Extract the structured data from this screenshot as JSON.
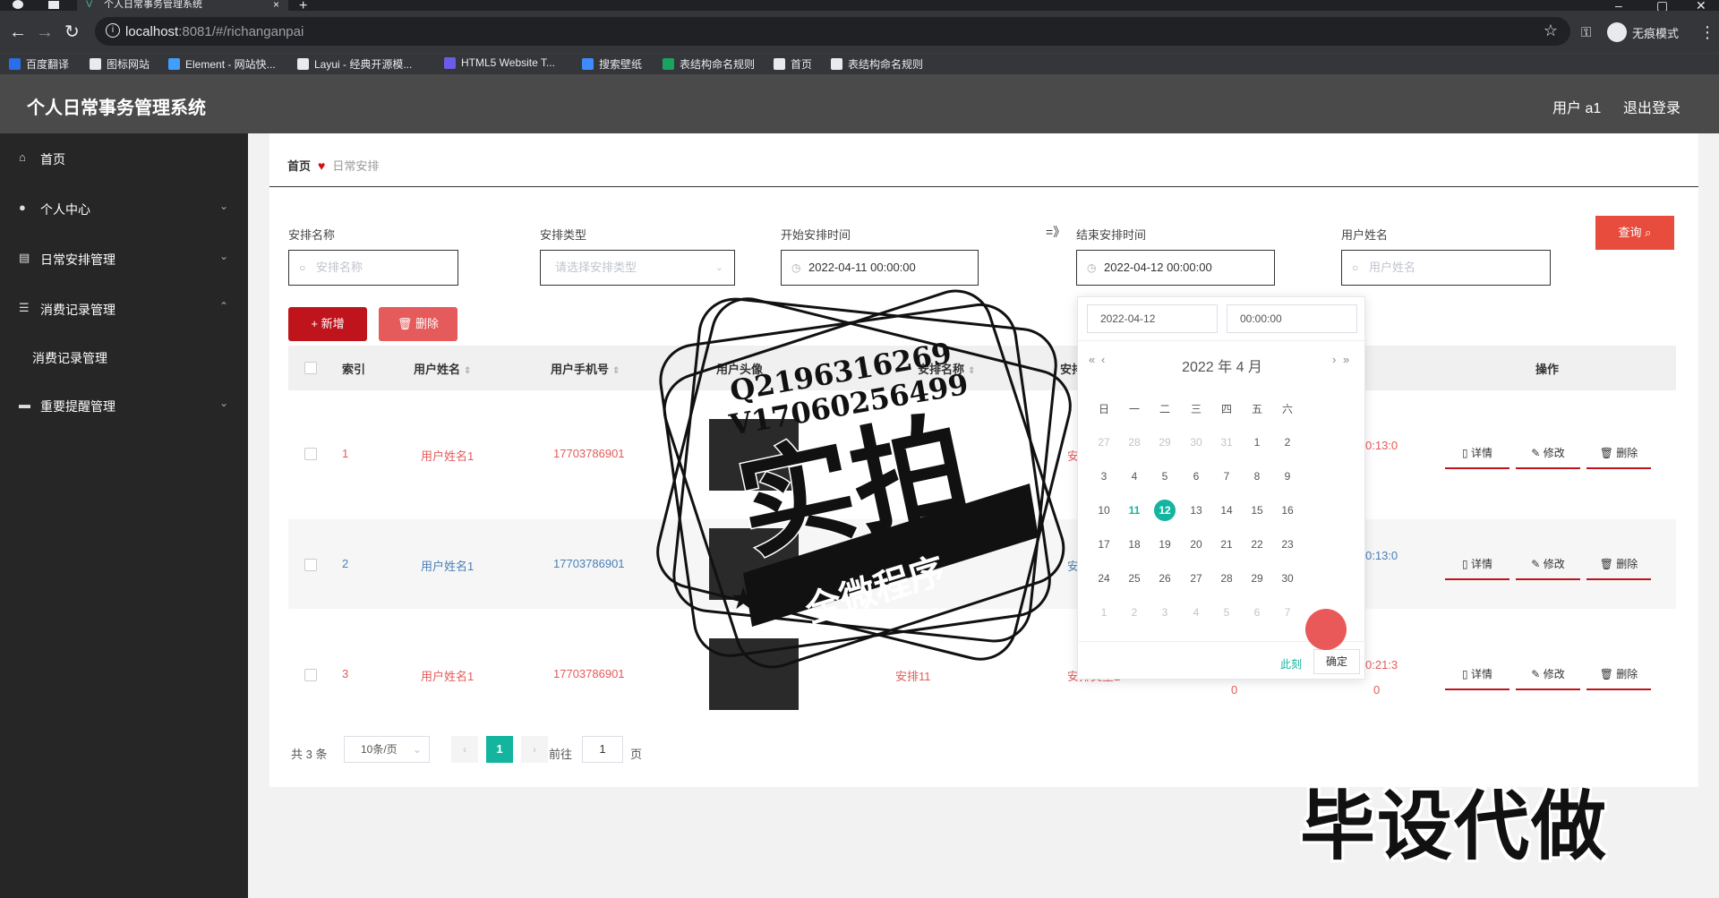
{
  "browser": {
    "tab_title": "个人日常事务管理系统",
    "url_host": "localhost",
    "url_path": ":8081/#/richanganpai",
    "incognito_label": "无痕模式",
    "bookmarks": [
      {
        "label": "百度翻译",
        "color": "#2a6ee8"
      },
      {
        "label": "图标网站",
        "color": "#e8eaed"
      },
      {
        "label": "Element - 网站快...",
        "color": "#409eff"
      },
      {
        "label": "Layui - 经典开源模...",
        "color": "#e8eaed"
      },
      {
        "label": "HTML5 Website T...",
        "color": "#6b5ce7"
      },
      {
        "label": "搜索壁纸",
        "color": "#3d8bfd"
      },
      {
        "label": "表结构命名规则",
        "color": "#1aa260"
      },
      {
        "label": "首页",
        "color": "#e8eaed"
      },
      {
        "label": "表结构命名规则",
        "color": "#e8eaed"
      }
    ]
  },
  "header": {
    "title": "个人日常事务管理系统",
    "user": "用户 a1",
    "logout": "退出登录"
  },
  "sidebar": {
    "items": [
      {
        "label": "首页",
        "icon": "home-icon",
        "arrow": ""
      },
      {
        "label": "个人中心",
        "icon": "user-icon",
        "arrow": "⌄"
      },
      {
        "label": "日常安排管理",
        "icon": "calendar-icon",
        "arrow": "⌄"
      },
      {
        "label": "消费记录管理",
        "icon": "list-icon",
        "arrow": "⌃"
      },
      {
        "label": "消费记录管理",
        "icon": "",
        "arrow": ""
      },
      {
        "label": "重要提醒管理",
        "icon": "bell-icon",
        "arrow": "⌄"
      }
    ]
  },
  "breadcrumb": {
    "home": "首页",
    "current": "日常安排"
  },
  "filters": {
    "name_label": "安排名称",
    "name_placeholder": "安排名称",
    "type_label": "安排类型",
    "type_placeholder": "请选择安排类型",
    "start_label": "开始安排时间",
    "start_value": "2022-04-11 00:00:00",
    "arrow": "=》",
    "end_label": "结束安排时间",
    "end_value": "2022-04-12 00:00:00",
    "user_label": "用户姓名",
    "user_placeholder": "用户姓名",
    "query_btn": "查询"
  },
  "actions": {
    "add": "新增",
    "delete": "删除"
  },
  "table": {
    "headers": [
      "索引",
      "用户姓名",
      "用户手机号",
      "用户头像",
      "安排名称",
      "安排类型",
      "操作"
    ],
    "rows": [
      {
        "index": "1",
        "name": "用户姓名1",
        "phone": "17703786901",
        "arr_name": "",
        "arr_type": "安排类型",
        "time": "0:13:0",
        "count_a": "",
        "count_b": ""
      },
      {
        "index": "2",
        "name": "用户姓名1",
        "phone": "17703786901",
        "arr_name": "",
        "arr_type": "安排类型",
        "time": "0:13:0",
        "count_a": "",
        "count_b": ""
      },
      {
        "index": "3",
        "name": "用户姓名1",
        "phone": "17703786901",
        "arr_name": "安排11",
        "arr_type": "安排类型1",
        "time": "0:21:3",
        "count_a": "0",
        "count_b": "0"
      }
    ],
    "ops": {
      "detail": "详情",
      "edit": "修改",
      "delete": "删除"
    }
  },
  "pagination": {
    "total": "共 3 条",
    "page_size": "10条/页",
    "current": "1",
    "goto_prefix": "前往",
    "goto_value": "1",
    "goto_suffix": "页"
  },
  "datepicker": {
    "date_value": "2022-04-12",
    "time_value": "00:00:00",
    "header": "2022 年  4 月",
    "weekdays": [
      "日",
      "一",
      "二",
      "三",
      "四",
      "五",
      "六"
    ],
    "weeks": [
      [
        "27",
        "28",
        "29",
        "30",
        "31",
        "1",
        "2"
      ],
      [
        "3",
        "4",
        "5",
        "6",
        "7",
        "8",
        "9"
      ],
      [
        "10",
        "11",
        "12",
        "13",
        "14",
        "15",
        "16"
      ],
      [
        "17",
        "18",
        "19",
        "20",
        "21",
        "22",
        "23"
      ],
      [
        "24",
        "25",
        "26",
        "27",
        "28",
        "29",
        "30"
      ],
      [
        "1",
        "2",
        "3",
        "4",
        "5",
        "6",
        "7"
      ]
    ],
    "today": "11",
    "selected": "12",
    "now_btn": "此刻",
    "ok_btn": "确定"
  },
  "watermark": {
    "phone_q": "Q2196316269",
    "phone_v": "V17060256499",
    "big": "实拍",
    "banner": "全微程序",
    "bottom": "毕设代做"
  }
}
